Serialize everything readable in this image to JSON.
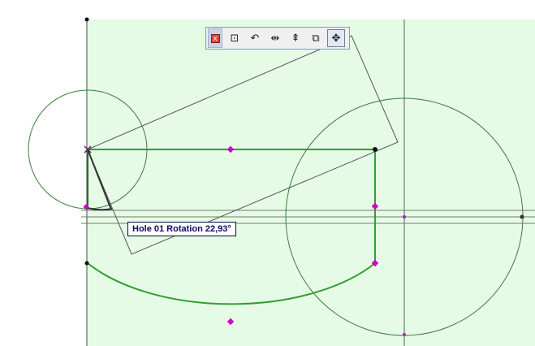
{
  "colors": {
    "canvas_fill": "#e6fbe6",
    "hole_outline": "#2fa02f",
    "guide_line": "#4b6b4b",
    "hotspot": "#cc00cc"
  },
  "toolbar": {
    "buttons": [
      {
        "name": "close-icon",
        "glyph": "x"
      },
      {
        "name": "move-node-icon",
        "glyph": "⊡"
      },
      {
        "name": "rotate-icon",
        "glyph": "↶"
      },
      {
        "name": "mirror-icon",
        "glyph": "⇹"
      },
      {
        "name": "elevate-icon",
        "glyph": "⇞"
      },
      {
        "name": "offset-icon",
        "glyph": "⧉"
      },
      {
        "name": "drag-icon",
        "glyph": "✥"
      }
    ],
    "active": "drag-icon"
  },
  "tooltip": {
    "text": "Hole 01 Rotation  22,93°"
  }
}
